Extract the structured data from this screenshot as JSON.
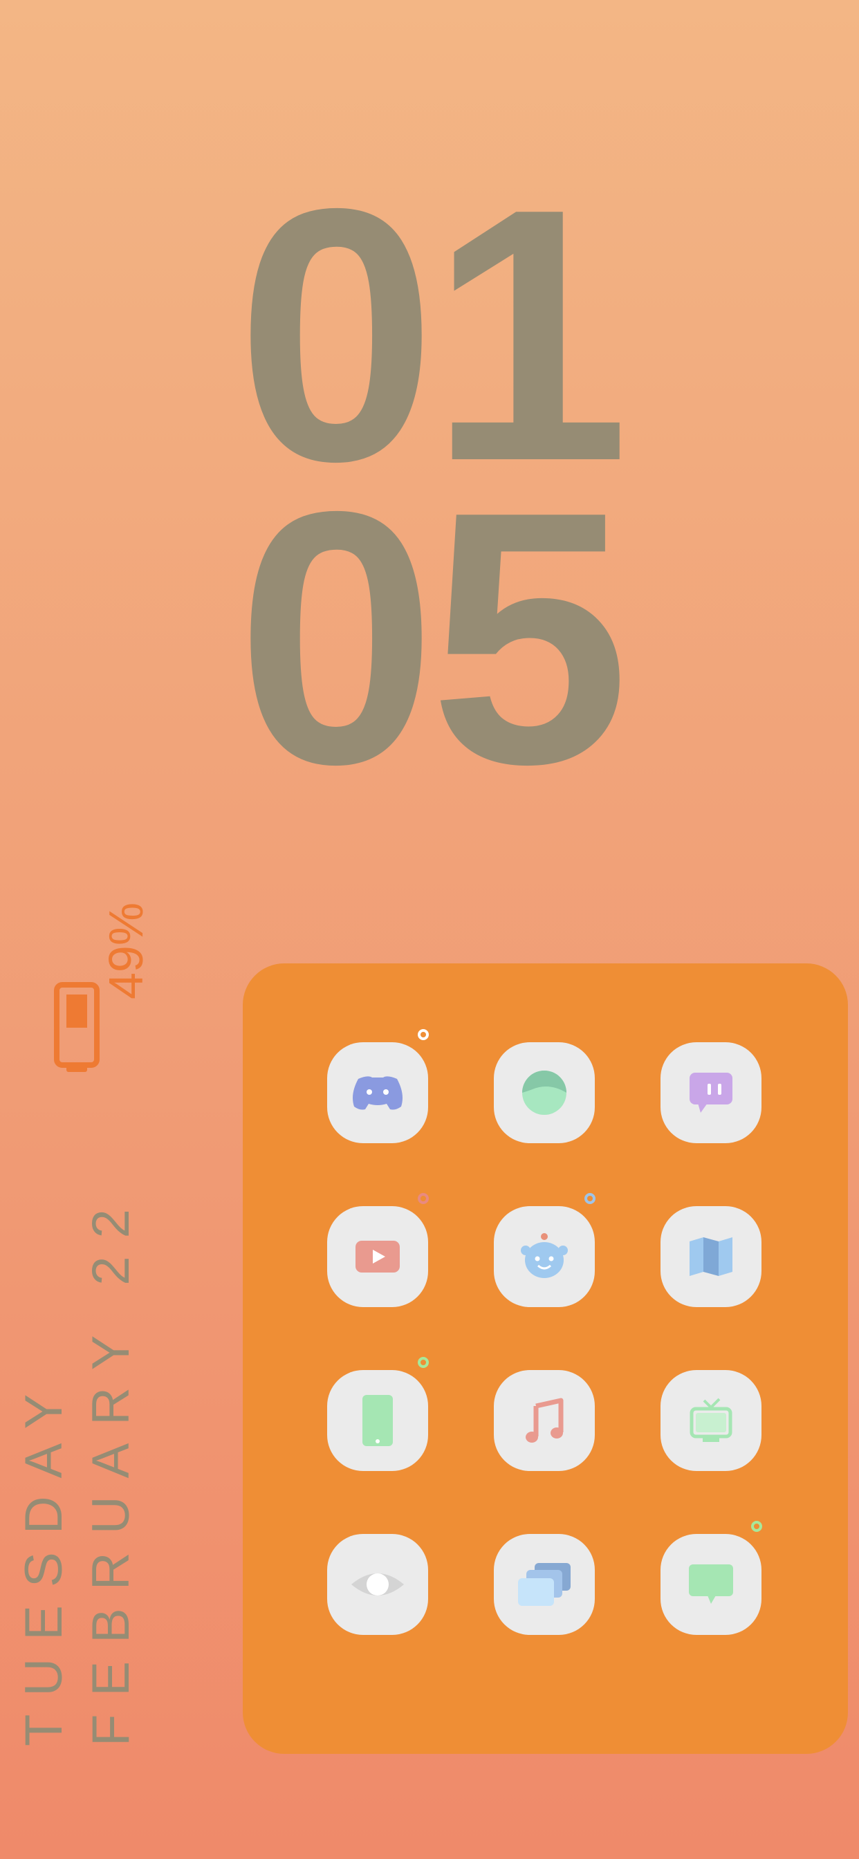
{
  "clock": {
    "hour": "01",
    "minute": "05"
  },
  "battery": {
    "percent_text": "49%",
    "level": 0.49
  },
  "date": {
    "weekday": "TUESDAY",
    "month_day": "FEBRUARY 22"
  },
  "colors": {
    "background_top": "#f3b685",
    "background_bottom": "#ef8a6a",
    "clock_text": "#968c74",
    "panel": "#ef8e35",
    "battery": "#ee7a33",
    "app_tile": "#ebebeb"
  },
  "apps": [
    {
      "name": "discord-icon",
      "dot": "#ffffff"
    },
    {
      "name": "sphere-icon",
      "dot": null
    },
    {
      "name": "twitch-icon",
      "dot": null
    },
    {
      "name": "youtube-icon",
      "dot": "#e98a80"
    },
    {
      "name": "reddit-icon",
      "dot": "#9fc4e8"
    },
    {
      "name": "maps-icon",
      "dot": null
    },
    {
      "name": "phone-icon",
      "dot": "#a8e89a"
    },
    {
      "name": "music-icon",
      "dot": null
    },
    {
      "name": "tv-icon",
      "dot": null
    },
    {
      "name": "eye-icon",
      "dot": null
    },
    {
      "name": "gallery-icon",
      "dot": null
    },
    {
      "name": "messages-icon",
      "dot": "#a8e89a"
    }
  ]
}
